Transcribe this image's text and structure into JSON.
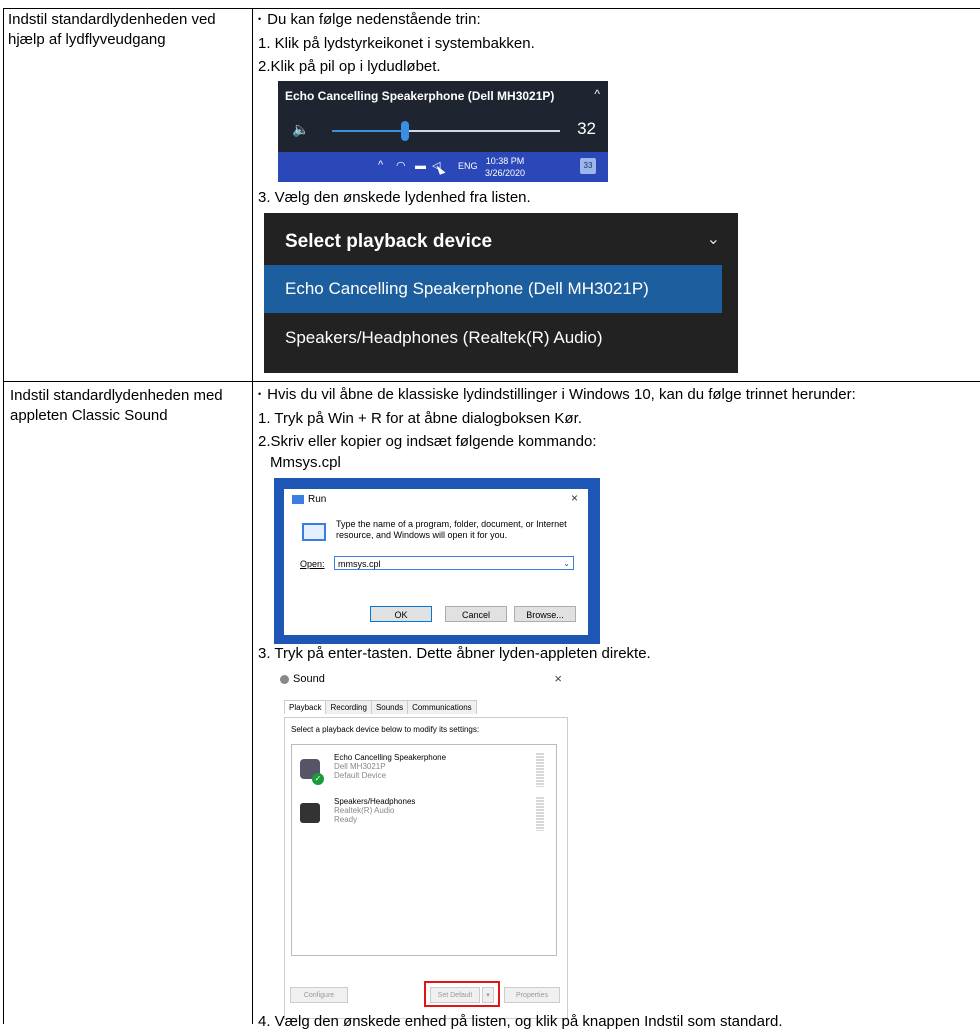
{
  "row1": {
    "left_label": "Indstil standardlydenheden ved hjælp af lydflyveudgang",
    "lines": [
      "Du kan følge nedenstående trin:",
      "1. Klik på lydstyrkeikonet i systembakken.",
      "2.Klik på pil op i lydudløbet.",
      "3. Vælg den ønskede lydenhed fra listen."
    ],
    "flyout": {
      "device": "Echo Cancelling Speakerphone (Dell MH3021P)",
      "volume": "32",
      "volume_level_percent": 32,
      "lang": "ENG",
      "time": "10:38 PM",
      "date": "3/26/2020",
      "notifications": "33"
    },
    "device_list": {
      "heading": "Select playback device",
      "items": [
        "Echo Cancelling Speakerphone (Dell MH3021P)",
        "Speakers/Headphones (Realtek(R) Audio)"
      ]
    }
  },
  "row2": {
    "left_label": "Indstil standardlydenheden med appleten Classic Sound",
    "lines": [
      "Hvis du vil åbne de klassiske lydindstillinger i Windows 10, kan du følge trinnet herunder:",
      "1. Tryk på Win + R for at åbne dialogboksen Kør.",
      "2.Skriv eller kopier og indsæt følgende kommando:",
      "Mmsys.cpl",
      "3. Tryk på enter-tasten. Dette åbner lyden-appleten direkte.",
      "4. Vælg den ønskede enhed på listen, og klik på knappen Indstil som standard."
    ],
    "run_dialog": {
      "title": "Run",
      "desc_1": "Type the name of a program, folder, document, or Internet",
      "desc_2": "resource, and Windows will open it for you.",
      "open_label": "Open:",
      "value": "mmsys.cpl",
      "ok": "OK",
      "cancel": "Cancel",
      "browse": "Browse..."
    },
    "sound_dialog": {
      "title": "Sound",
      "tabs": [
        "Playback",
        "Recording",
        "Sounds",
        "Communications"
      ],
      "instruction": "Select a playback device below to modify its settings:",
      "devices": [
        {
          "name": "Echo Cancelling Speakerphone",
          "line2": "Dell MH3021P",
          "line3": "Default Device"
        },
        {
          "name": "Speakers/Headphones",
          "line2": "Realtek(R) Audio",
          "line3": "Ready"
        }
      ],
      "configure": "Configure",
      "set_default": "Set Default",
      "properties": "Properties"
    }
  }
}
